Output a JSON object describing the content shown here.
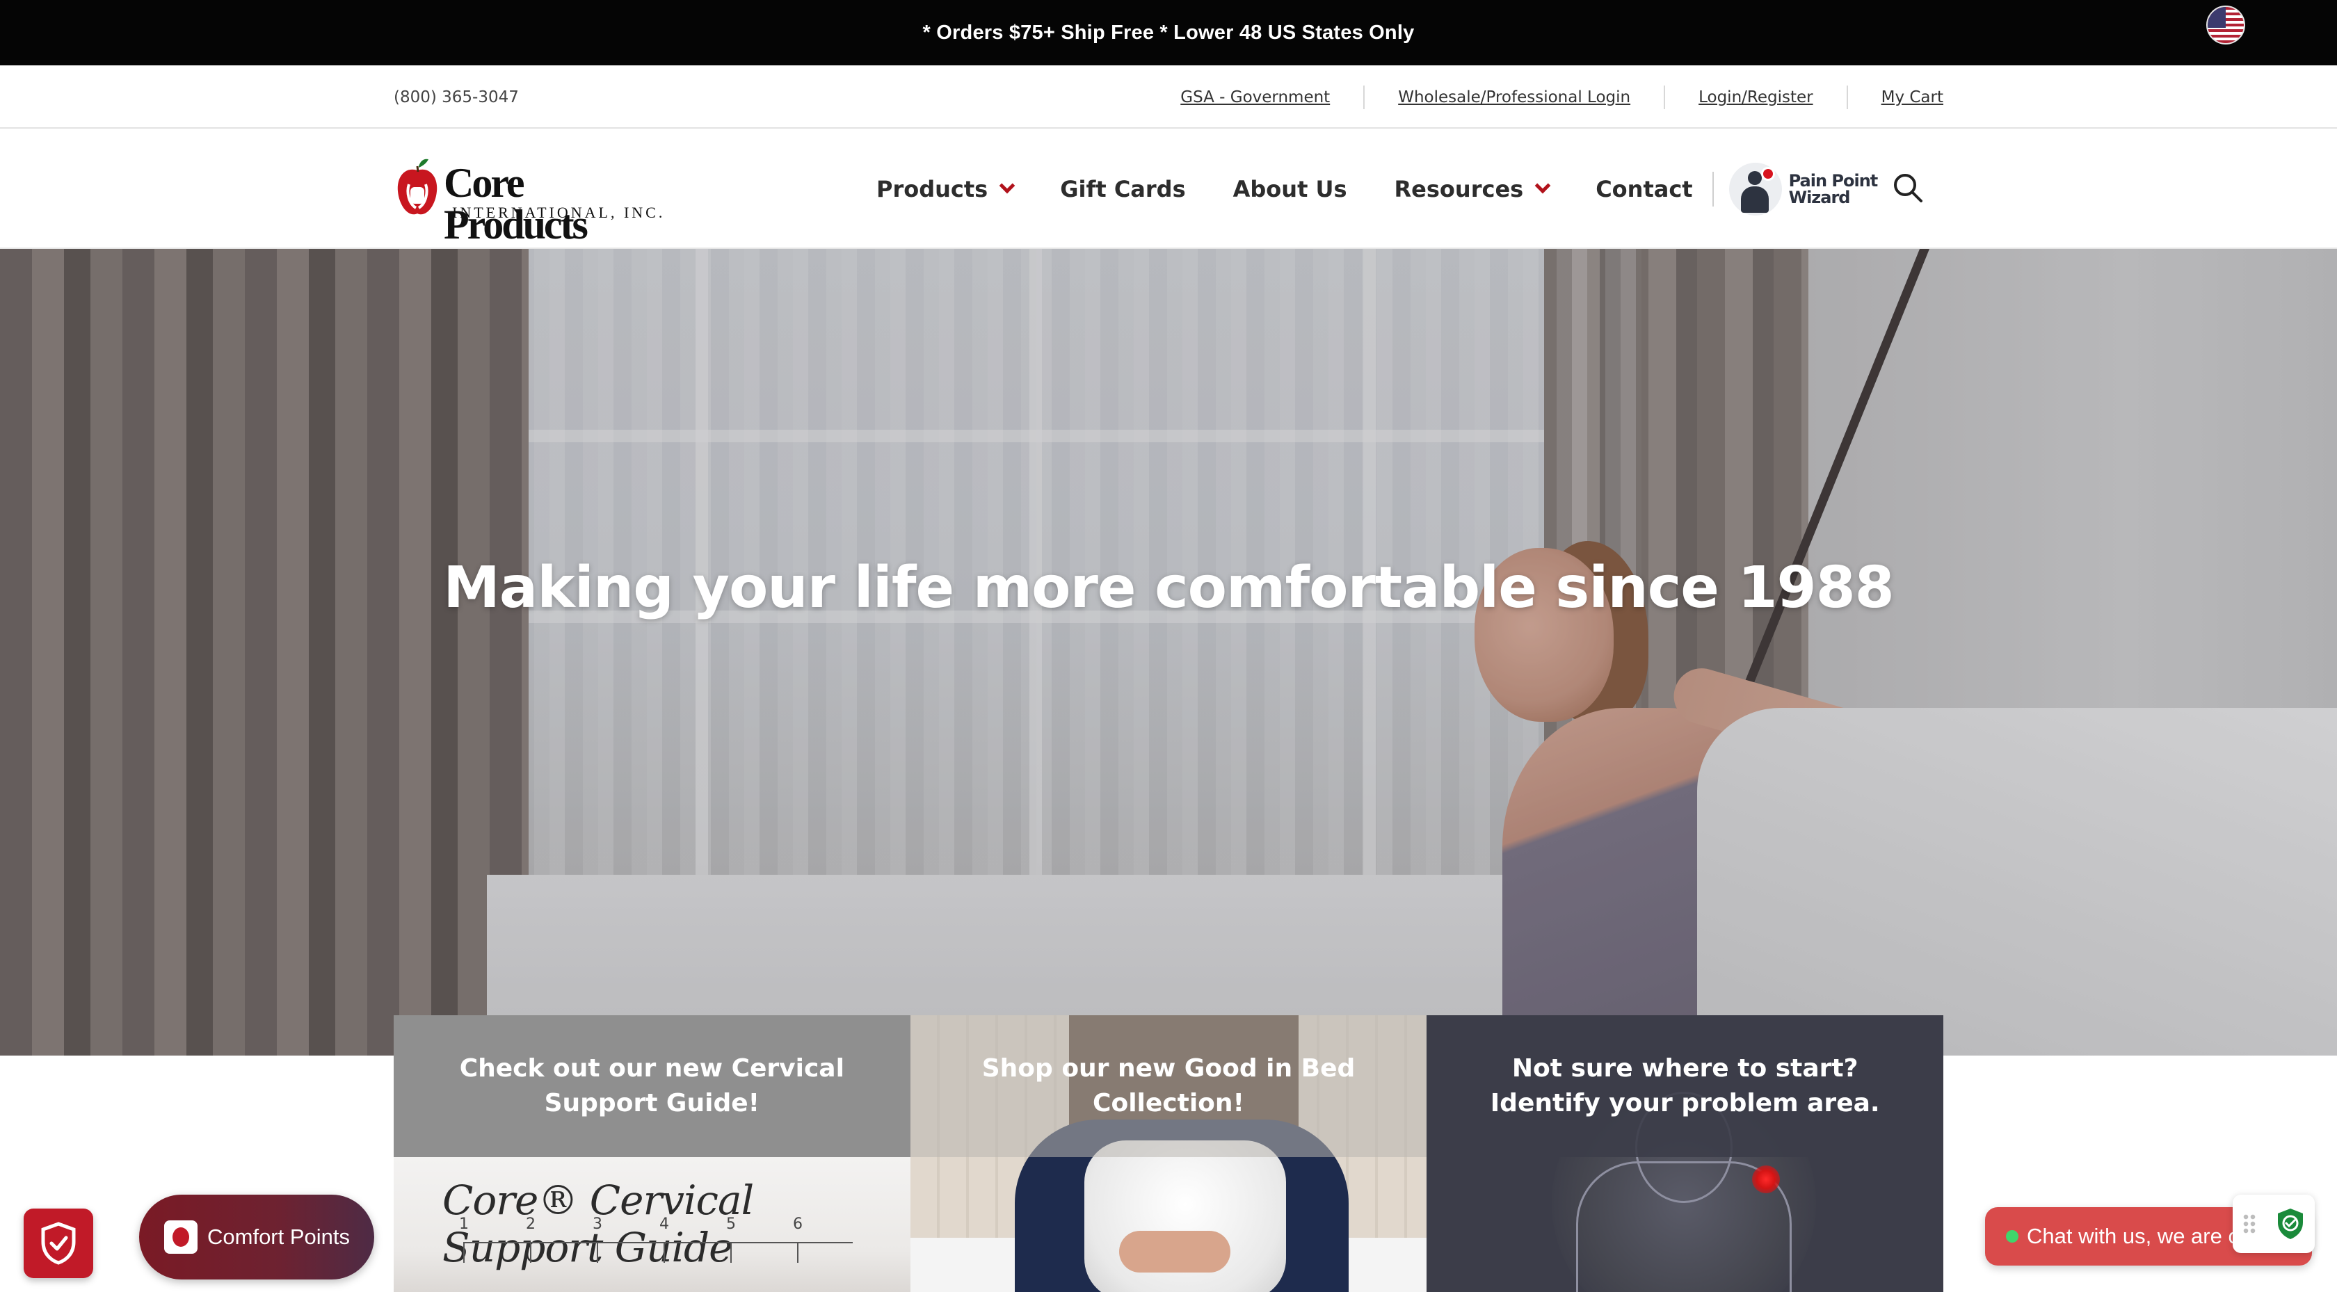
{
  "announcement": {
    "text": "* Orders $75+ Ship Free * Lower 48 US States Only",
    "flag_icon": "us-flag-icon"
  },
  "utility": {
    "phone": "(800) 365-3047",
    "links": [
      "GSA - Government",
      "Wholesale/Professional Login",
      "Login/Register",
      "My Cart "
    ]
  },
  "header": {
    "logo": {
      "wordmark": "Core Products",
      "subline": "INTERNATIONAL, INC."
    },
    "nav": [
      {
        "label": "Products",
        "has_dropdown": true
      },
      {
        "label": "Gift Cards",
        "has_dropdown": false
      },
      {
        "label": "About Us",
        "has_dropdown": false
      },
      {
        "label": "Resources",
        "has_dropdown": true
      },
      {
        "label": "Contact",
        "has_dropdown": false
      }
    ],
    "pain_point_wizard": "Pain Point Wizard",
    "search_icon": "search-icon"
  },
  "hero": {
    "title": "Making your life more comfortable since 1988"
  },
  "cards": [
    {
      "title": "Check out our new Cervical Support Guide!",
      "image_text": "Core® Cervical Support Guide",
      "ruler_numbers": [
        "1",
        "2",
        "3",
        "4",
        "5",
        "6"
      ]
    },
    {
      "title": "Shop our new Good in Bed Collection!"
    },
    {
      "title": "Not sure where to start? Identify your problem area."
    }
  ],
  "widgets": {
    "comfort_points": "Comfort Points",
    "chat": "Chat with us, we are online!",
    "shield_icon": "shield-check-icon",
    "trust_icon": "shield-check-icon"
  },
  "colors": {
    "brand_red": "#b1121b",
    "announce_bg": "#050505",
    "chat_bg": "#d94b4b",
    "comfort_bg": "#7a1a25"
  }
}
